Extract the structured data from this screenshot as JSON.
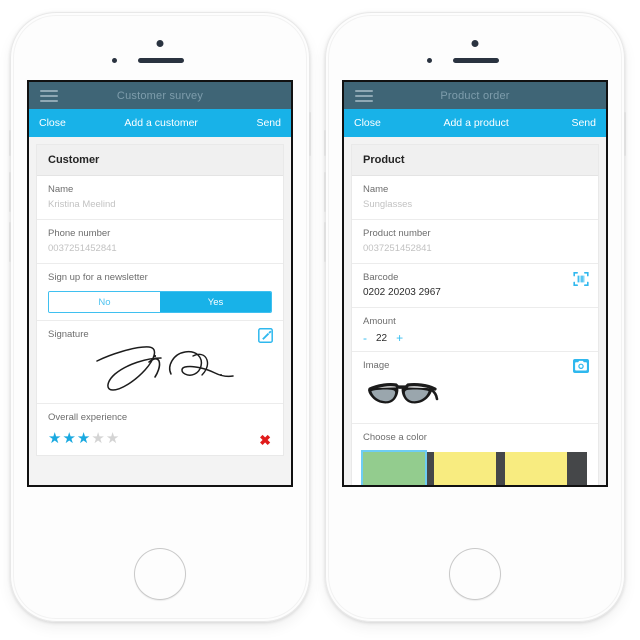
{
  "phones": [
    {
      "id": "customer-survey",
      "topbar": {
        "title": "Customer survey",
        "menu_icon": "hamburger-icon"
      },
      "navbar": {
        "left": "Close",
        "center": "Add a customer",
        "right": "Send"
      },
      "card_title": "Customer",
      "fields": [
        {
          "label": "Name",
          "value": "Kristina Meelind"
        },
        {
          "label": "Phone number",
          "value": "0037251452841"
        }
      ],
      "newsletter": {
        "label": "Sign up for a newsletter",
        "options": [
          "No",
          "Yes"
        ],
        "selected": "Yes"
      },
      "signature": {
        "label": "Signature",
        "icon": "edit-pencil-icon"
      },
      "experience": {
        "label": "Overall experience",
        "rating": 3,
        "max": 5,
        "clear_icon": "red-x-icon"
      }
    },
    {
      "id": "product-order",
      "topbar": {
        "title": "Product order",
        "menu_icon": "hamburger-icon"
      },
      "navbar": {
        "left": "Close",
        "center": "Add a product",
        "right": "Send"
      },
      "card_title": "Product",
      "fields": [
        {
          "label": "Name",
          "value": "Sunglasses"
        },
        {
          "label": "Product number",
          "value": "0037251452841"
        }
      ],
      "barcode": {
        "label": "Barcode",
        "value": "0202 20203 2967",
        "icon": "barcode-scanner-icon"
      },
      "amount": {
        "label": "Amount",
        "value": "22",
        "minus": "-",
        "plus": "+"
      },
      "image": {
        "label": "Image",
        "icon": "camera-icon",
        "alt": "sunglasses-photo"
      },
      "color": {
        "label": "Choose a color",
        "swatches": [
          "#454749",
          "#93cc8e",
          "#f8ec80"
        ],
        "selected_index": 0
      }
    }
  ],
  "colors": {
    "topbar": "#3f6576",
    "navbar": "#18b2e8",
    "accent": "#18b2e8",
    "star_on": "#1aa9e0",
    "star_off": "#d4d4d4",
    "x_red": "#e01b1b"
  }
}
